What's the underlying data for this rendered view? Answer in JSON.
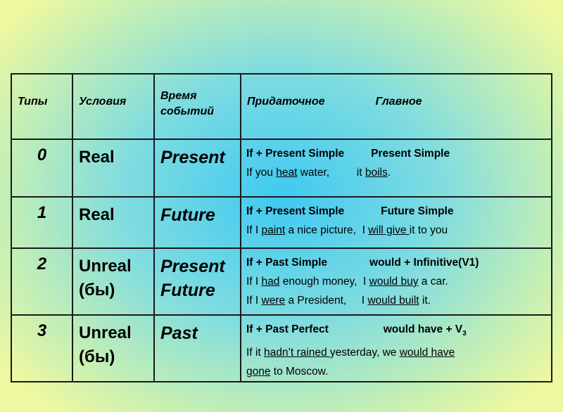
{
  "header": {
    "types": "Типы",
    "conditions": "Условия",
    "time": "Время событий",
    "subordinate": "Придаточное",
    "main": "Главное"
  },
  "rows": [
    {
      "type": "0",
      "condition": "Real",
      "time": "Present",
      "formula_if": "If + Present Simple",
      "formula_main": "Present Simple",
      "examples": [
        [
          {
            "t": "If you "
          },
          {
            "t": "heat",
            "u": true
          },
          {
            "t": " water,         it "
          },
          {
            "t": "boils",
            "u": true
          },
          {
            "t": "."
          }
        ]
      ]
    },
    {
      "type": "1",
      "condition": "Real",
      "time": "Future",
      "formula_if": "If + Present Simple",
      "formula_main": "Future Simple",
      "examples": [
        [
          {
            "t": "If I "
          },
          {
            "t": "paint",
            "u": true
          },
          {
            "t": " a nice picture,  I "
          },
          {
            "t": "will give ",
            "u": true
          },
          {
            "t": "it to you"
          }
        ]
      ]
    },
    {
      "type": "2",
      "condition": "Unreal (бы)",
      "time": "Present Future",
      "formula_if": "If + Past Simple",
      "formula_main": "would + Infinitive(V1)",
      "examples": [
        [
          {
            "t": "If I "
          },
          {
            "t": "had",
            "u": true
          },
          {
            "t": " enough money,  I "
          },
          {
            "t": "would buy",
            "u": true
          },
          {
            "t": " a car."
          }
        ],
        [
          {
            "t": "If I "
          },
          {
            "t": "were",
            "u": true
          },
          {
            "t": " a President,     I "
          },
          {
            "t": "would built",
            "u": true
          },
          {
            "t": " it."
          }
        ]
      ]
    },
    {
      "type": "3",
      "condition": "Unreal (бы)",
      "time": "Past",
      "formula_if": "If + Past Perfect",
      "formula_main": "would have + V",
      "formula_main_sub": "3",
      "examples": [
        [
          {
            "t": "If it "
          },
          {
            "t": "hadn’t rained ",
            "u": true
          },
          {
            "t": "yesterday, we "
          },
          {
            "t": "would have",
            "u": true
          }
        ],
        [
          {
            "t": "gone",
            "u": true
          },
          {
            "t": " to Moscow."
          }
        ]
      ]
    }
  ]
}
